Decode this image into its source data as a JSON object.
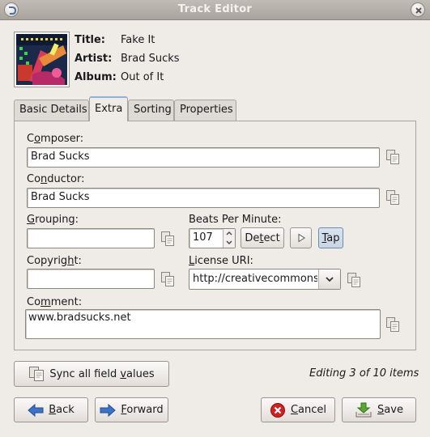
{
  "window": {
    "title": "Track Editor"
  },
  "info": {
    "title_label": "Title:",
    "title_value": "Fake It",
    "artist_label": "Artist:",
    "artist_value": "Brad Sucks",
    "album_label": "Album:",
    "album_value": "Out of It"
  },
  "tabs": [
    {
      "label": "Basic Details"
    },
    {
      "label": "Extra"
    },
    {
      "label": "Sorting"
    },
    {
      "label": "Properties"
    }
  ],
  "active_tab": "Extra",
  "fields": {
    "composer_pre": "C",
    "composer_ul": "o",
    "composer_post": "mposer:",
    "composer_value": "Brad Sucks",
    "conductor_pre": "Co",
    "conductor_ul": "n",
    "conductor_post": "ductor:",
    "conductor_value": "Brad Sucks",
    "grouping_ul": "G",
    "grouping_post": "rouping:",
    "grouping_value": "",
    "bpm_label": "Beats Per Minute:",
    "bpm_value": "107",
    "detect_pre": "De",
    "detect_ul": "t",
    "detect_post": "ect",
    "tap_ul": "T",
    "tap_post": "ap",
    "copyright_pre": "Copyrig",
    "copyright_ul": "h",
    "copyright_post": "t:",
    "copyright_value": "",
    "license_ul": "L",
    "license_post": "icense URI:",
    "license_value": "http://creativecommons",
    "comment_pre": "Co",
    "comment_ul": "m",
    "comment_post": "ment:",
    "comment_value": "www.bradsucks.net"
  },
  "sync": {
    "pre": "Sync all field ",
    "ul": "v",
    "post": "alues"
  },
  "status": "Editing 3 of 10 items",
  "nav": {
    "back_ul": "B",
    "back_post": "ack",
    "forward_ul": "F",
    "forward_post": "orward",
    "cancel_ul": "C",
    "cancel_post": "ancel",
    "save_ul": "S",
    "save_post": "ave"
  },
  "icons": [
    "menu-icon",
    "close-icon",
    "copy-icon",
    "spin-up-icon",
    "spin-down-icon",
    "play-icon",
    "chevron-down-icon",
    "sync-icon",
    "back-arrow-icon",
    "forward-arrow-icon",
    "cancel-icon",
    "save-icon"
  ],
  "colors": {
    "accent": "#8fb1d8",
    "cancel": "#d21f1f",
    "save": "#5aa832",
    "nav_arrow": "#3d72c4"
  }
}
